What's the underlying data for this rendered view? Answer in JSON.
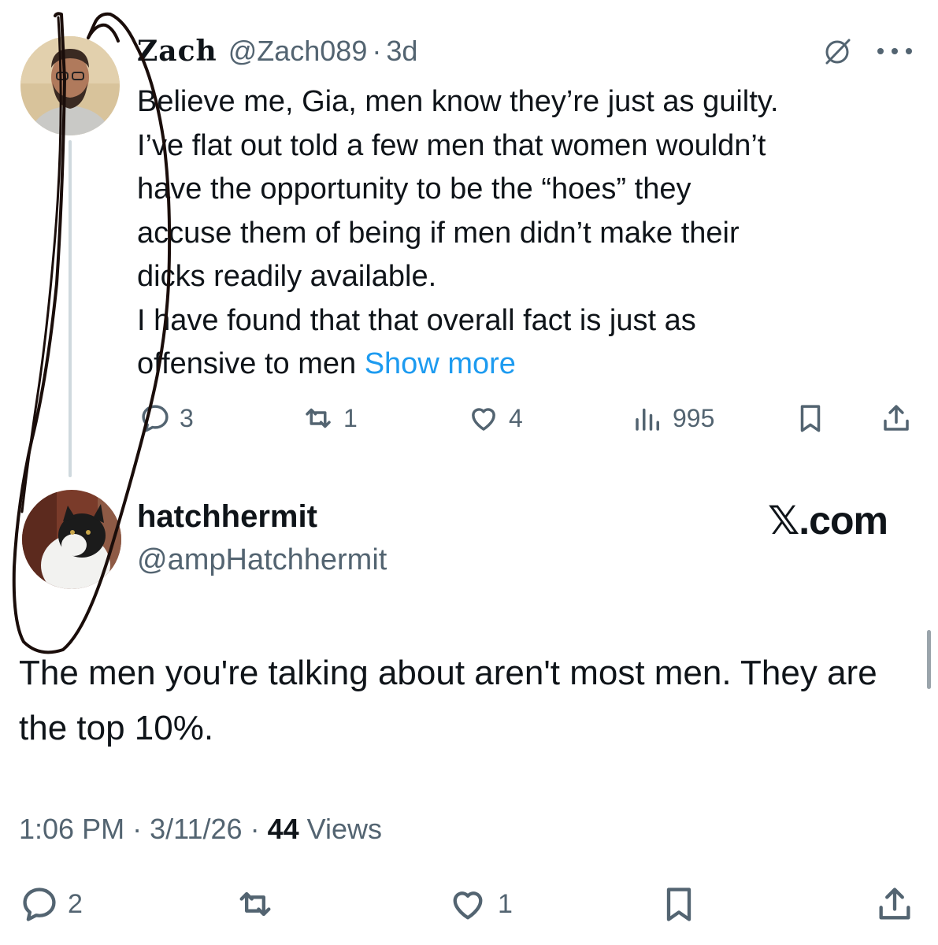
{
  "reply_tweet": {
    "display_name": "Zach",
    "handle": "@Zach089",
    "separator": "·",
    "age": "3d",
    "body_lines": [
      "Believe me, Gia, men know they’re just as guilty.",
      "I’ve flat out told a few men that women wouldn’t",
      "have the opportunity to be the “hoes” they",
      "accuse them of being if men didn’t make their",
      "dicks readily available.",
      "I have found that that overall fact is just as"
    ],
    "last_line": "offensive to men",
    "show_more": "Show more",
    "replies": "3",
    "reposts": "1",
    "likes": "4",
    "views": "995",
    "icons": [
      "grok-icon",
      "more-icon",
      "reply-icon",
      "repost-icon",
      "like-icon",
      "views-icon",
      "bookmark-icon",
      "share-icon"
    ]
  },
  "quoted_author": {
    "name": "hatchhermit",
    "handle": "@ampHatchhermit"
  },
  "brand": "𝕏.com",
  "main_text": "The men you're talking about aren't most men. They are the top 10%.",
  "footer": {
    "time": "1:06 PM",
    "separator": "·",
    "date": "3/11/26",
    "views_count": "44",
    "views_label": "Views",
    "replies": "2",
    "likes": "1"
  },
  "colors": {
    "text": "#0f1419",
    "muted": "#536471",
    "link": "#1d9bf0",
    "thread_line": "#cfd9de",
    "annotation_ink": "#1a0d0a"
  }
}
